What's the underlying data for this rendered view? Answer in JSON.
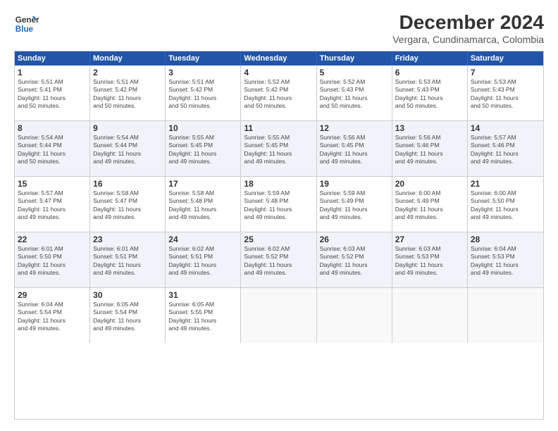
{
  "logo": {
    "line1": "General",
    "line2": "Blue"
  },
  "title": "December 2024",
  "subtitle": "Vergara, Cundinamarca, Colombia",
  "header_days": [
    "Sunday",
    "Monday",
    "Tuesday",
    "Wednesday",
    "Thursday",
    "Friday",
    "Saturday"
  ],
  "weeks": [
    {
      "days": [
        {
          "num": "1",
          "info": "Sunrise: 5:51 AM\nSunset: 5:41 PM\nDaylight: 11 hours\nand 50 minutes."
        },
        {
          "num": "2",
          "info": "Sunrise: 5:51 AM\nSunset: 5:42 PM\nDaylight: 11 hours\nand 50 minutes."
        },
        {
          "num": "3",
          "info": "Sunrise: 5:51 AM\nSunset: 5:42 PM\nDaylight: 11 hours\nand 50 minutes."
        },
        {
          "num": "4",
          "info": "Sunrise: 5:52 AM\nSunset: 5:42 PM\nDaylight: 11 hours\nand 50 minutes."
        },
        {
          "num": "5",
          "info": "Sunrise: 5:52 AM\nSunset: 5:43 PM\nDaylight: 11 hours\nand 50 minutes."
        },
        {
          "num": "6",
          "info": "Sunrise: 5:53 AM\nSunset: 5:43 PM\nDaylight: 11 hours\nand 50 minutes."
        },
        {
          "num": "7",
          "info": "Sunrise: 5:53 AM\nSunset: 5:43 PM\nDaylight: 11 hours\nand 50 minutes."
        }
      ]
    },
    {
      "days": [
        {
          "num": "8",
          "info": "Sunrise: 5:54 AM\nSunset: 5:44 PM\nDaylight: 11 hours\nand 50 minutes."
        },
        {
          "num": "9",
          "info": "Sunrise: 5:54 AM\nSunset: 5:44 PM\nDaylight: 11 hours\nand 49 minutes."
        },
        {
          "num": "10",
          "info": "Sunrise: 5:55 AM\nSunset: 5:45 PM\nDaylight: 11 hours\nand 49 minutes."
        },
        {
          "num": "11",
          "info": "Sunrise: 5:55 AM\nSunset: 5:45 PM\nDaylight: 11 hours\nand 49 minutes."
        },
        {
          "num": "12",
          "info": "Sunrise: 5:56 AM\nSunset: 5:45 PM\nDaylight: 11 hours\nand 49 minutes."
        },
        {
          "num": "13",
          "info": "Sunrise: 5:56 AM\nSunset: 5:46 PM\nDaylight: 11 hours\nand 49 minutes."
        },
        {
          "num": "14",
          "info": "Sunrise: 5:57 AM\nSunset: 5:46 PM\nDaylight: 11 hours\nand 49 minutes."
        }
      ]
    },
    {
      "days": [
        {
          "num": "15",
          "info": "Sunrise: 5:57 AM\nSunset: 5:47 PM\nDaylight: 11 hours\nand 49 minutes."
        },
        {
          "num": "16",
          "info": "Sunrise: 5:58 AM\nSunset: 5:47 PM\nDaylight: 11 hours\nand 49 minutes."
        },
        {
          "num": "17",
          "info": "Sunrise: 5:58 AM\nSunset: 5:48 PM\nDaylight: 11 hours\nand 49 minutes."
        },
        {
          "num": "18",
          "info": "Sunrise: 5:59 AM\nSunset: 5:48 PM\nDaylight: 11 hours\nand 49 minutes."
        },
        {
          "num": "19",
          "info": "Sunrise: 5:59 AM\nSunset: 5:49 PM\nDaylight: 11 hours\nand 49 minutes."
        },
        {
          "num": "20",
          "info": "Sunrise: 6:00 AM\nSunset: 5:49 PM\nDaylight: 11 hours\nand 49 minutes."
        },
        {
          "num": "21",
          "info": "Sunrise: 6:00 AM\nSunset: 5:50 PM\nDaylight: 11 hours\nand 49 minutes."
        }
      ]
    },
    {
      "days": [
        {
          "num": "22",
          "info": "Sunrise: 6:01 AM\nSunset: 5:50 PM\nDaylight: 11 hours\nand 49 minutes."
        },
        {
          "num": "23",
          "info": "Sunrise: 6:01 AM\nSunset: 5:51 PM\nDaylight: 11 hours\nand 49 minutes."
        },
        {
          "num": "24",
          "info": "Sunrise: 6:02 AM\nSunset: 5:51 PM\nDaylight: 11 hours\nand 49 minutes."
        },
        {
          "num": "25",
          "info": "Sunrise: 6:02 AM\nSunset: 5:52 PM\nDaylight: 11 hours\nand 49 minutes."
        },
        {
          "num": "26",
          "info": "Sunrise: 6:03 AM\nSunset: 5:52 PM\nDaylight: 11 hours\nand 49 minutes."
        },
        {
          "num": "27",
          "info": "Sunrise: 6:03 AM\nSunset: 5:53 PM\nDaylight: 11 hours\nand 49 minutes."
        },
        {
          "num": "28",
          "info": "Sunrise: 6:04 AM\nSunset: 5:53 PM\nDaylight: 11 hours\nand 49 minutes."
        }
      ]
    },
    {
      "days": [
        {
          "num": "29",
          "info": "Sunrise: 6:04 AM\nSunset: 5:54 PM\nDaylight: 11 hours\nand 49 minutes."
        },
        {
          "num": "30",
          "info": "Sunrise: 6:05 AM\nSunset: 5:54 PM\nDaylight: 11 hours\nand 49 minutes."
        },
        {
          "num": "31",
          "info": "Sunrise: 6:05 AM\nSunset: 5:55 PM\nDaylight: 11 hours\nand 49 minutes."
        },
        {
          "num": "",
          "info": ""
        },
        {
          "num": "",
          "info": ""
        },
        {
          "num": "",
          "info": ""
        },
        {
          "num": "",
          "info": ""
        }
      ]
    }
  ]
}
